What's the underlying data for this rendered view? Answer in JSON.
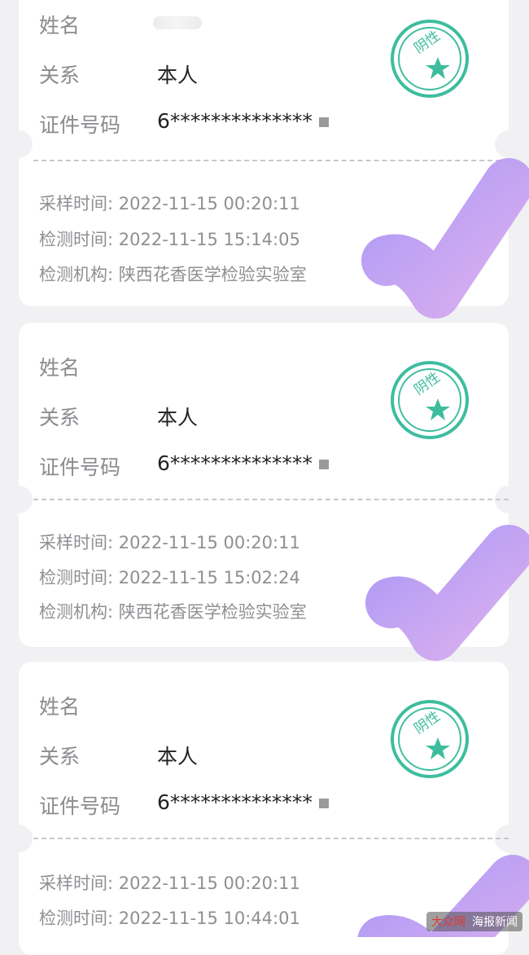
{
  "labels": {
    "name": "姓名",
    "relation": "关系",
    "id_number": "证件号码",
    "sample_time": "采样时间:",
    "test_time": "检测时间:",
    "test_org": "检测机构:"
  },
  "stamp_text": "阴性",
  "records": [
    {
      "relation": "本人",
      "id_number": "6**************",
      "sample_time": "2022-11-15 00:20:11",
      "test_time": "2022-11-15 15:14:05",
      "test_org": "陕西花香医学检验实验室"
    },
    {
      "relation": "本人",
      "id_number": "6**************",
      "sample_time": "2022-11-15 00:20:11",
      "test_time": "2022-11-15 15:02:24",
      "test_org": "陕西花香医学检验实验室"
    },
    {
      "relation": "本人",
      "id_number": "6**************",
      "sample_time": "2022-11-15 00:20:11",
      "test_time": "2022-11-15 10:44:01",
      "test_org": ""
    }
  ],
  "watermark": {
    "left": "大众网",
    "right": "海报新闻"
  },
  "colors": {
    "stamp": "#3dbd9e",
    "check_start": "#a892f5",
    "check_end": "#d7a8ee"
  }
}
